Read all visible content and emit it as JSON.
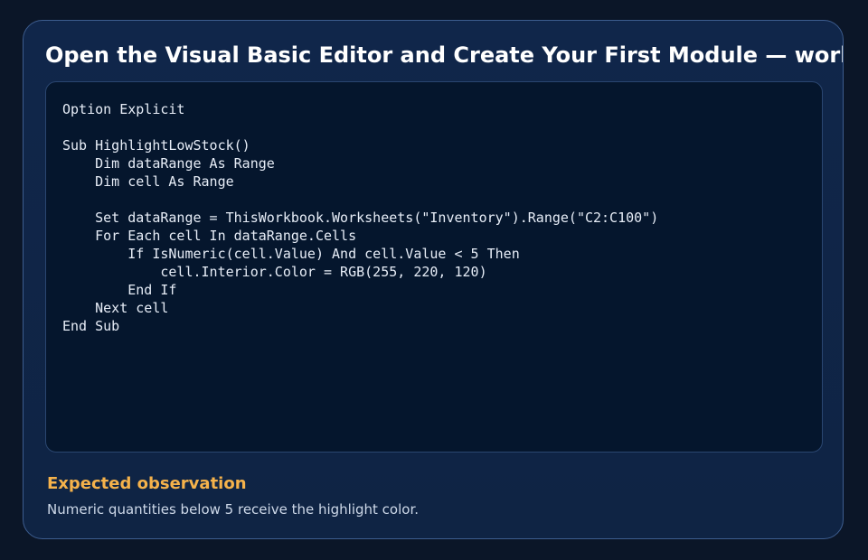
{
  "title": "Open the Visual Basic Editor and Create Your First Module — worked example",
  "code": {
    "language": "vba",
    "text": "Option Explicit\n\nSub HighlightLowStock()\n    Dim dataRange As Range\n    Dim cell As Range\n\n    Set dataRange = ThisWorkbook.Worksheets(\"Inventory\").Range(\"C2:C100\")\n    For Each cell In dataRange.Cells\n        If IsNumeric(cell.Value) And cell.Value < 5 Then\n            cell.Interior.Color = RGB(255, 220, 120)\n        End If\n    Next cell\nEnd Sub"
  },
  "observation": {
    "heading": "Expected observation",
    "text": "Numeric quantities below 5 receive the highlight color."
  },
  "colors": {
    "background": "#0b1628",
    "card": "#10264a",
    "card_border": "#3d5d8f",
    "code_background": "#05162d",
    "accent": "#f5b24b"
  }
}
